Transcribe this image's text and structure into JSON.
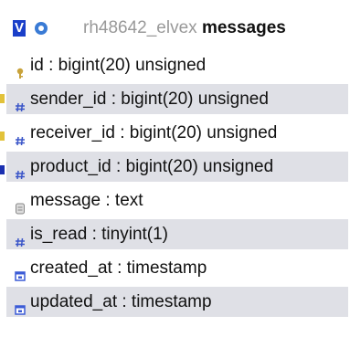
{
  "header": {
    "v_label": "V",
    "database": "rh48642_elvex",
    "table": "messages"
  },
  "columns": [
    {
      "text": "id : bigint(20) unsigned",
      "icon": "key-icon",
      "shaded": false
    },
    {
      "text": "sender_id : bigint(20) unsigned",
      "icon": "hash-icon",
      "shaded": true
    },
    {
      "text": "receiver_id : bigint(20) unsigned",
      "icon": "hash-icon",
      "shaded": false
    },
    {
      "text": "product_id : bigint(20) unsigned",
      "icon": "hash-icon",
      "shaded": true
    },
    {
      "text": "message : text",
      "icon": "text-icon",
      "shaded": false
    },
    {
      "text": "is_read : tinyint(1)",
      "icon": "hash-icon",
      "shaded": true
    },
    {
      "text": "created_at : timestamp",
      "icon": "timestamp-icon",
      "shaded": false
    },
    {
      "text": "updated_at : timestamp",
      "icon": "timestamp-icon",
      "shaded": true
    }
  ],
  "colors": {
    "key": "#c8a23a",
    "hash": "#3a55c8",
    "timestamp": "#3b5bd6",
    "text": "#888888",
    "shade": "#dfe0e6",
    "marker_yellow": "#e2c23a",
    "marker_blue": "#1a2fb0"
  }
}
